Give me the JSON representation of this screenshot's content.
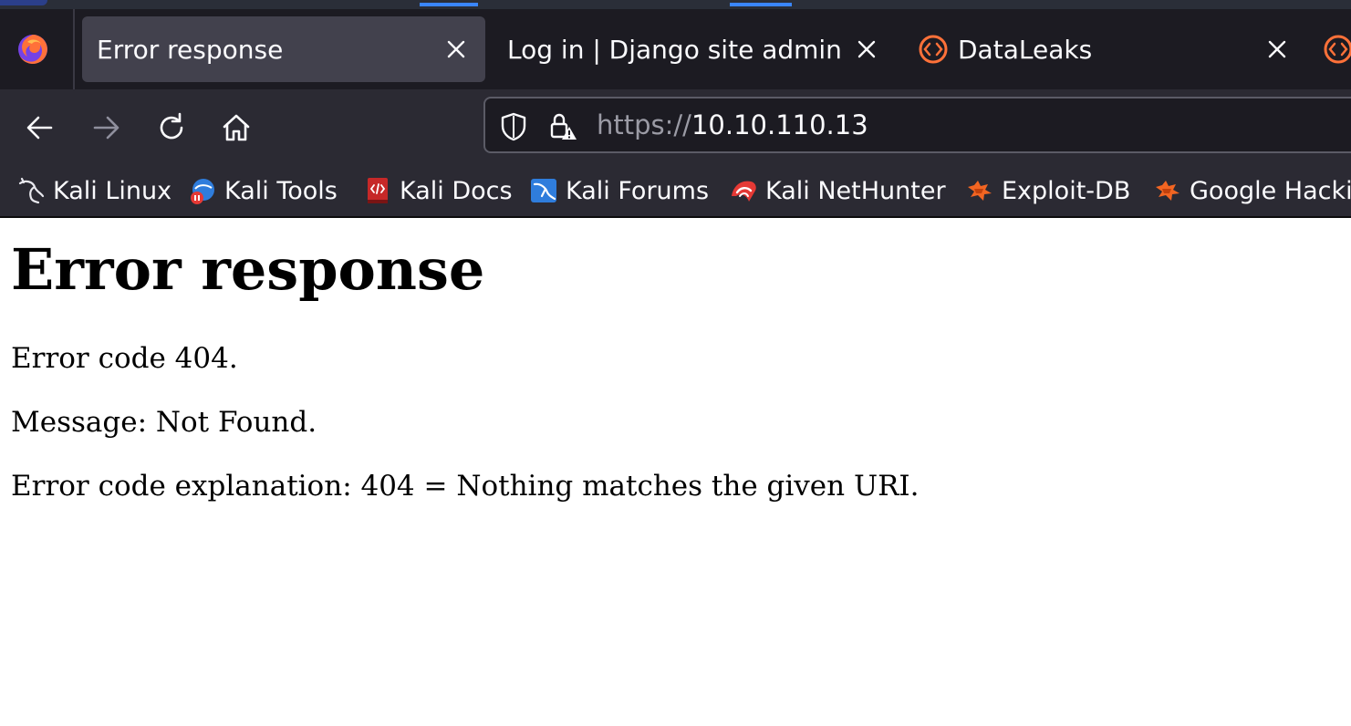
{
  "browser": {
    "tabs": [
      {
        "title": "Error response",
        "active": true
      },
      {
        "title": "Log in | Django site admin",
        "active": false
      },
      {
        "title": "DataLeaks",
        "active": false
      }
    ],
    "nav": {
      "back_icon": "arrow-left-icon",
      "forward_icon": "arrow-right-icon",
      "reload_icon": "reload-icon",
      "home_icon": "home-icon"
    },
    "url": {
      "scheme": "https://",
      "host": "10.10.110.13"
    },
    "bookmarks": [
      {
        "label": "Kali Linux",
        "icon": "kali-dragon-icon"
      },
      {
        "label": "Kali Tools",
        "icon": "kali-tools-icon"
      },
      {
        "label": "Kali Docs",
        "icon": "kali-docs-icon"
      },
      {
        "label": "Kali Forums",
        "icon": "kali-forums-icon"
      },
      {
        "label": "Kali NetHunter",
        "icon": "kali-nethunter-icon"
      },
      {
        "label": "Exploit-DB",
        "icon": "exploit-db-icon"
      },
      {
        "label": "Google Hackin",
        "icon": "google-hacking-icon"
      }
    ],
    "colors": {
      "tabbar_bg": "#1c1b22",
      "toolbar_bg": "#2b2a33",
      "active_tab_bg": "#42414d",
      "accent": "#3a86ff"
    }
  },
  "page": {
    "heading": "Error response",
    "error_code_line": "Error code 404.",
    "message_line": "Message: Not Found.",
    "explanation_line": "Error code explanation: 404 = Nothing matches the given URI."
  }
}
